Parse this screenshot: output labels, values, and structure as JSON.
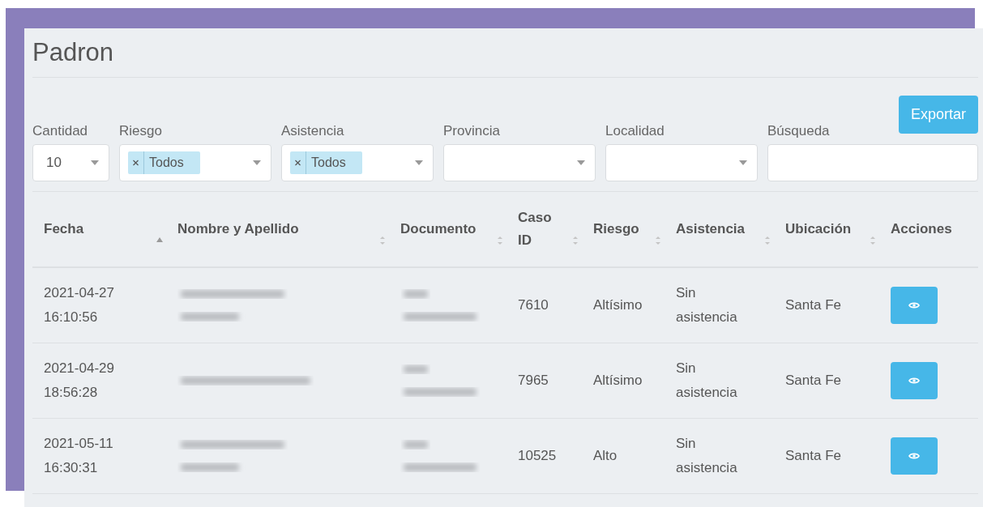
{
  "title": "Padron",
  "export_button": "Exportar",
  "filters": [
    {
      "kind": "select",
      "label": "Cantidad",
      "value": "10"
    },
    {
      "kind": "multi",
      "label": "Riesgo",
      "tags": [
        "Todos"
      ]
    },
    {
      "kind": "multi",
      "label": "Asistencia",
      "tags": [
        "Todos"
      ]
    },
    {
      "kind": "select",
      "label": "Provincia"
    },
    {
      "kind": "select",
      "label": "Localidad"
    },
    {
      "kind": "text",
      "label": "Búsqueda"
    }
  ],
  "table": {
    "columns": [
      {
        "label": "Fecha",
        "sortable": true,
        "sorted": true
      },
      {
        "label": "Nombre y Apellido",
        "sortable": true,
        "sorted": false
      },
      {
        "label": "Documento",
        "sortable": true,
        "sorted": false
      },
      {
        "label": "Caso ID",
        "sortable": true,
        "sorted": false
      },
      {
        "label": "Riesgo",
        "sortable": true,
        "sorted": false
      },
      {
        "label": "Asistencia",
        "sortable": true,
        "sorted": false
      },
      {
        "label": "Ubicación",
        "sortable": true,
        "sorted": false
      },
      {
        "label": "Acciones",
        "sortable": false
      }
    ],
    "rows": [
      {
        "fecha": "2021-04-27 16:10:56",
        "nombre": {
          "kind": "blurred-two-line"
        },
        "documento": {
          "kind": "blurred-two-line"
        },
        "caso": "7610",
        "riesgo": "Altísimo",
        "asistencia": "Sin asistencia",
        "ubicacion": "Santa Fe"
      },
      {
        "fecha": "2021-04-29 18:56:28",
        "nombre": {
          "kind": "blurred-one-line"
        },
        "documento": {
          "kind": "blurred-two-line"
        },
        "caso": "7965",
        "riesgo": "Altísimo",
        "asistencia": "Sin asistencia",
        "ubicacion": "Santa Fe"
      },
      {
        "fecha": "2021-05-11 16:30:31",
        "nombre": {
          "kind": "blurred-two-line"
        },
        "documento": {
          "kind": "blurred-two-line"
        },
        "caso": "10525",
        "riesgo": "Alto",
        "asistencia": "Sin asistencia",
        "ubicacion": "Santa Fe"
      }
    ]
  }
}
